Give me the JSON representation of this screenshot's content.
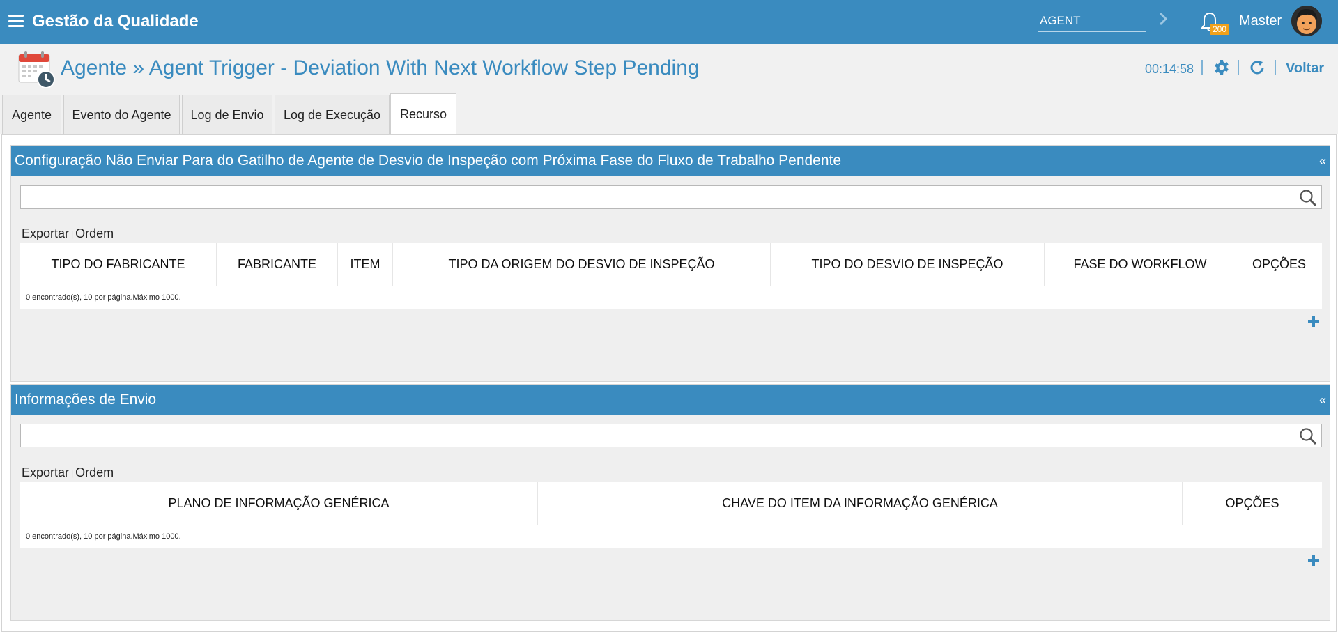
{
  "topbar": {
    "app_title": "Gestão da Qualidade",
    "module_value": "AGENT",
    "notification_count": "200",
    "user_name": "Master"
  },
  "header": {
    "title": "Agente » Agent Trigger - Deviation With Next Workflow Step Pending",
    "timer": "00:14:58",
    "back_label": "Voltar"
  },
  "tabs": [
    {
      "label": "Agente",
      "active": false
    },
    {
      "label": "Evento do Agente",
      "active": false
    },
    {
      "label": "Log de Envio",
      "active": false
    },
    {
      "label": "Log de Execução",
      "active": false
    },
    {
      "label": "Recurso",
      "active": true
    }
  ],
  "panels": {
    "config": {
      "title": "Configuração Não Enviar Para do Gatilho de Agente de Desvio de Inspeção com Próxima Fase do Fluxo de Trabalho Pendente",
      "collapse_glyph": "«",
      "export_label": "Exportar",
      "order_label": "Ordem",
      "columns": [
        "TIPO DO FABRICANTE",
        "FABRICANTE",
        "ITEM",
        "TIPO DA ORIGEM DO DESVIO DE INSPEÇÃO",
        "TIPO DO DESVIO DE INSPEÇÃO",
        "FASE DO WORKFLOW",
        "OPÇÕES"
      ],
      "footer": {
        "found": "0 encontrado(s), ",
        "per_page": "10",
        "per_page_text": " por página.Máximo ",
        "max": "1000",
        "end": "."
      }
    },
    "envio": {
      "title": "Informações de Envio",
      "collapse_glyph": "«",
      "export_label": "Exportar",
      "order_label": "Ordem",
      "columns": [
        "PLANO DE INFORMAÇÃO GENÉRICA",
        "CHAVE DO ITEM DA INFORMAÇÃO GENÉRICA",
        "OPÇÕES"
      ],
      "footer": {
        "found": "0 encontrado(s), ",
        "per_page": "10",
        "per_page_text": " por página.Máximo ",
        "max": "1000",
        "end": "."
      }
    }
  },
  "colors": {
    "primary": "#3a8bbf",
    "badge": "#f0a11b",
    "panel_bg": "#efefef"
  }
}
